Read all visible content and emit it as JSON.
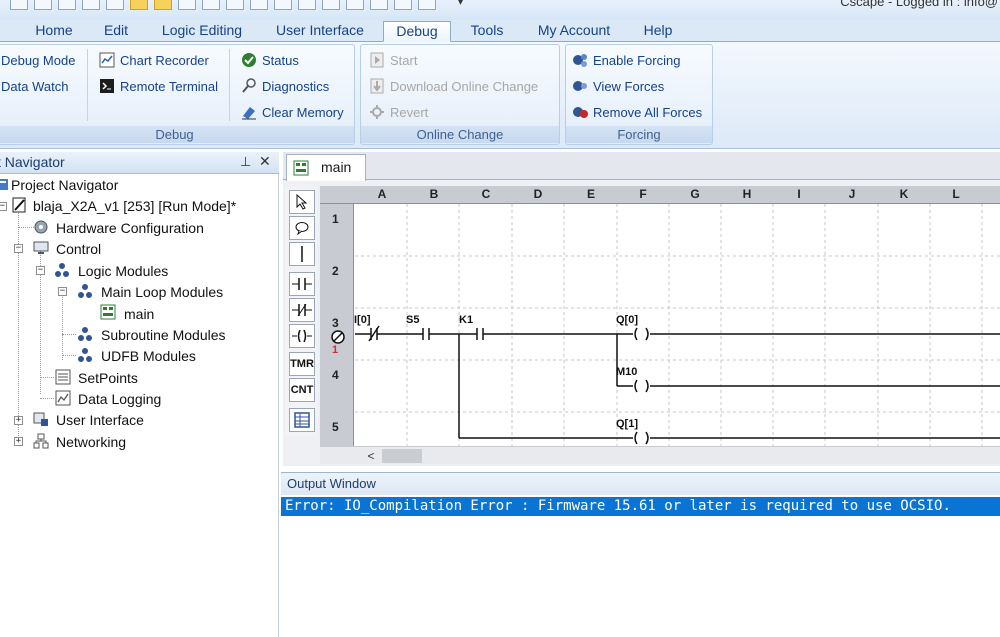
{
  "window": {
    "title": "Cscape - Logged in : info@"
  },
  "menu": {
    "tabs": [
      {
        "label": "Home"
      },
      {
        "label": "Edit"
      },
      {
        "label": "Logic Editing"
      },
      {
        "label": "User Interface"
      },
      {
        "label": "Debug",
        "active": true
      },
      {
        "label": "Tools"
      },
      {
        "label": "My Account"
      },
      {
        "label": "Help"
      }
    ]
  },
  "ribbon": {
    "debug": {
      "label": "Debug",
      "debug_mode": "Debug Mode",
      "data_watch": "Data Watch",
      "chart_recorder": "Chart Recorder",
      "remote_terminal": "Remote Terminal",
      "status": "Status",
      "diagnostics": "Diagnostics",
      "clear_memory": "Clear Memory"
    },
    "online_change": {
      "label": "Online Change",
      "start": "Start",
      "download": "Download Online Change",
      "revert": "Revert"
    },
    "forcing": {
      "label": "Forcing",
      "enable": "Enable Forcing",
      "view": "View Forces",
      "remove": "Remove All Forces"
    }
  },
  "navigator": {
    "title": "ct Navigator",
    "pin_glyph": "⊥",
    "close_glyph": "✕",
    "items": [
      "Project Navigator",
      "blaja_X2A_v1 [253] [Run Mode]*",
      "Hardware Configuration",
      "Control",
      "Logic Modules",
      "Main Loop Modules",
      "main",
      "Subroutine Modules",
      "UDFB Modules",
      "SetPoints",
      "Data Logging",
      "User Interface",
      "Networking"
    ]
  },
  "editor": {
    "tab_label": "main",
    "columns": [
      "A",
      "B",
      "C",
      "D",
      "E",
      "F",
      "G",
      "H",
      "I",
      "J",
      "K",
      "L"
    ],
    "rows": [
      "1",
      "2",
      "3",
      "4",
      "5"
    ],
    "error_marker": "1",
    "tools": [
      "select",
      "comment",
      "wire",
      "contact-no",
      "contact-nc",
      "coil",
      "TMR",
      "CNT",
      "table"
    ],
    "rung_labels": {
      "i0": "I[0]",
      "s5": "S5",
      "k1": "K1",
      "q0": "Q[0]",
      "m10": "M10",
      "q1": "Q[1]"
    },
    "scroll_left": "<"
  },
  "output": {
    "title": "Output Window",
    "message": "Error: IO_Compilation Error : Firmware 15.61 or later is required to use OCSIO."
  },
  "colors": {
    "selection": "#0a74d4",
    "ribbon_text": "#15428b"
  }
}
